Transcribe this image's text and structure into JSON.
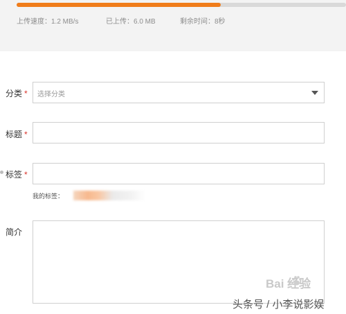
{
  "upload": {
    "progress_percent": 62,
    "speed_text": "上传速度：1.2 MB/s",
    "uploaded_text": "已上传：6.0 MB",
    "remaining_text": "剩余时间：8秒",
    "fill_color": "#f07d1b"
  },
  "form": {
    "required_mark": "*",
    "category": {
      "label": "分类",
      "placeholder": "选择分类"
    },
    "title": {
      "label": "标题",
      "value": ""
    },
    "tags": {
      "label": "标签",
      "value": "",
      "my_tags_label": "我的标签："
    },
    "intro": {
      "label": "简介",
      "value": ""
    }
  },
  "watermark": {
    "baidu_text": "Bai  经验",
    "author_text": "头条号 / 小李说影娱"
  },
  "colors": {
    "accent": "#f07d1b",
    "required": "#d9342b"
  }
}
